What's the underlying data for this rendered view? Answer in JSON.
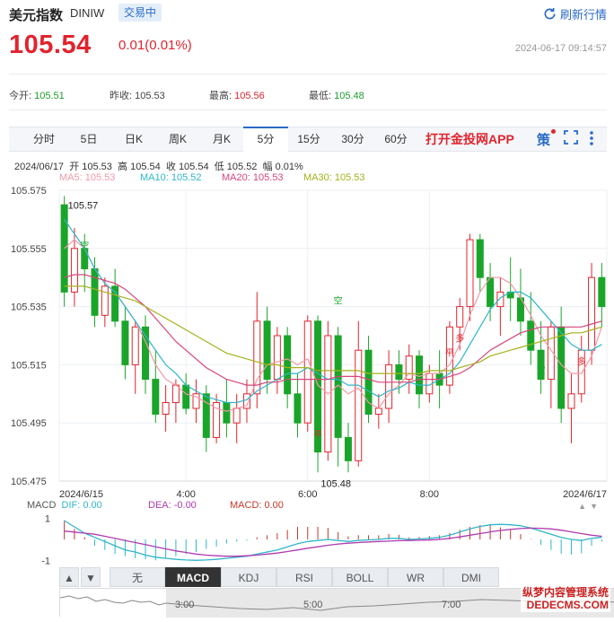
{
  "header": {
    "title": "美元指数",
    "code": "DINIW",
    "status": "交易中",
    "refresh_label": "刷新行情",
    "price": "105.54",
    "change": "0.01(0.01%)",
    "timestamp": "2024-06-17 09:14:57"
  },
  "stats": {
    "open_label": "今开:",
    "open": "105.51",
    "prev_label": "昨收:",
    "prev": "105.53",
    "high_label": "最高:",
    "high": "105.56",
    "low_label": "最低:",
    "low": "105.48"
  },
  "tabs": [
    "分时",
    "5日",
    "日K",
    "周K",
    "月K",
    "5分",
    "15分",
    "30分",
    "60分"
  ],
  "active_tab": "5分",
  "app_link": "打开金投网APP",
  "toolbar_icons": [
    "strategy-icon",
    "fullscreen-icon",
    "more-icon"
  ],
  "strategy_label": "策",
  "bar_info": {
    "date": "2024/06/17",
    "open_label": "开",
    "open": "105.53",
    "high_label": "高",
    "high": "105.54",
    "close_label": "收",
    "close": "105.54",
    "low_label": "低",
    "low": "105.52",
    "amp_label": "幅",
    "amp": "0.01%"
  },
  "ma_legend": [
    {
      "label": "MA5: 105.53",
      "color": "#f09aa8"
    },
    {
      "label": "MA10: 105.52",
      "color": "#2fb6c8"
    },
    {
      "label": "MA20: 105.53",
      "color": "#d6457d"
    },
    {
      "label": "MA30: 105.53",
      "color": "#a3b21c"
    }
  ],
  "macd_legend": {
    "name": "MACD",
    "dif": "DIF: 0.00",
    "dea": "DEA: -0.00",
    "macd": "MACD: 0.00",
    "dif_color": "#2fb6c8",
    "dea_color": "#b03ab0",
    "macd_color": "#c0392b"
  },
  "indicator_tabs": [
    "无",
    "MACD",
    "KDJ",
    "RSI",
    "BOLL",
    "WR",
    "DMI"
  ],
  "active_indicator": "MACD",
  "nav_arrows": [
    "▲",
    "▼"
  ],
  "navigator_ticks": [
    "3:00",
    "5:00",
    "7:00"
  ],
  "watermark": {
    "line1": "纵梦内容管理系统",
    "line2": "DEDECMS.COM"
  },
  "chart_data": {
    "type": "candlestick",
    "y_ticks": [
      "105.575",
      "105.555",
      "105.535",
      "105.515",
      "105.495",
      "105.475"
    ],
    "ylim": [
      105.475,
      105.575
    ],
    "x_ticks": [
      "2024/6/15",
      "4:00",
      "6:00",
      "8:00",
      "2024/6/17"
    ],
    "annotations": {
      "max": "105.57",
      "min": "105.48",
      "short": "空",
      "long": "多",
      "flat": "平"
    },
    "colors": {
      "up": "#e0242e",
      "down": "#1aa52a"
    },
    "candles": [
      [
        105.57,
        105.573,
        105.535,
        105.54
      ],
      [
        105.54,
        105.562,
        105.535,
        105.555
      ],
      [
        105.555,
        105.56,
        105.54,
        105.548
      ],
      [
        105.548,
        105.552,
        105.528,
        105.532
      ],
      [
        105.532,
        105.545,
        105.528,
        105.542
      ],
      [
        105.542,
        105.548,
        105.528,
        105.53
      ],
      [
        105.53,
        105.535,
        105.51,
        105.515
      ],
      [
        105.515,
        105.53,
        105.505,
        105.528
      ],
      [
        105.528,
        105.532,
        105.505,
        105.51
      ],
      [
        105.51,
        105.52,
        105.495,
        105.498
      ],
      [
        105.498,
        105.508,
        105.492,
        105.502
      ],
      [
        105.502,
        105.51,
        105.495,
        105.508
      ],
      [
        105.508,
        105.512,
        105.498,
        105.5
      ],
      [
        105.5,
        105.51,
        105.495,
        105.505
      ],
      [
        105.505,
        105.508,
        105.485,
        105.49
      ],
      [
        105.49,
        105.505,
        105.488,
        105.502
      ],
      [
        105.502,
        105.51,
        105.49,
        105.495
      ],
      [
        105.495,
        105.505,
        105.488,
        105.5
      ],
      [
        105.5,
        105.51,
        105.495,
        105.505
      ],
      [
        105.505,
        105.54,
        105.5,
        105.53
      ],
      [
        105.53,
        105.535,
        105.505,
        105.51
      ],
      [
        105.51,
        105.528,
        105.505,
        105.525
      ],
      [
        105.525,
        105.528,
        105.5,
        105.505
      ],
      [
        105.505,
        105.512,
        105.49,
        105.495
      ],
      [
        105.495,
        105.532,
        105.492,
        105.53
      ],
      [
        105.53,
        105.532,
        105.478,
        105.485
      ],
      [
        105.485,
        105.53,
        105.482,
        105.525
      ],
      [
        105.525,
        105.528,
        105.48,
        105.49
      ],
      [
        105.49,
        105.495,
        105.478,
        105.482
      ],
      [
        105.482,
        105.53,
        105.48,
        105.52
      ],
      [
        105.52,
        105.525,
        105.495,
        105.498
      ],
      [
        105.498,
        105.505,
        105.493,
        105.5
      ],
      [
        105.5,
        105.52,
        105.495,
        105.515
      ],
      [
        105.515,
        105.52,
        105.505,
        105.51
      ],
      [
        105.51,
        105.522,
        105.505,
        105.518
      ],
      [
        105.518,
        105.52,
        105.5,
        105.505
      ],
      [
        105.505,
        105.515,
        105.502,
        105.512
      ],
      [
        105.512,
        105.52,
        105.5,
        105.508
      ],
      [
        105.508,
        105.53,
        105.505,
        105.528
      ],
      [
        105.528,
        105.538,
        105.52,
        105.535
      ],
      [
        105.535,
        105.56,
        105.53,
        105.558
      ],
      [
        105.558,
        105.56,
        105.54,
        105.545
      ],
      [
        105.545,
        105.55,
        105.53,
        105.535
      ],
      [
        105.535,
        105.545,
        105.525,
        105.54
      ],
      [
        105.54,
        105.552,
        105.53,
        105.538
      ],
      [
        105.538,
        105.548,
        105.525,
        105.53
      ],
      [
        105.53,
        105.54,
        105.515,
        105.52
      ],
      [
        105.52,
        105.53,
        105.505,
        105.51
      ],
      [
        105.51,
        105.53,
        105.5,
        105.528
      ],
      [
        105.528,
        105.535,
        105.495,
        105.5
      ],
      [
        105.5,
        105.512,
        105.488,
        105.505
      ],
      [
        105.505,
        105.525,
        105.502,
        105.52
      ],
      [
        105.52,
        105.55,
        105.515,
        105.545
      ],
      [
        105.545,
        105.55,
        105.528,
        105.535
      ]
    ],
    "series": [
      {
        "name": "MA5",
        "color": "#f09aa8",
        "values": [
          105.555,
          105.558,
          105.555,
          105.548,
          105.543,
          105.54,
          105.535,
          105.53,
          105.523,
          105.515,
          105.51,
          105.508,
          105.505,
          105.504,
          105.502,
          105.5,
          105.499,
          105.5,
          105.501,
          105.51,
          105.515,
          105.516,
          105.517,
          105.515,
          105.517,
          105.508,
          105.505,
          105.508,
          105.505,
          105.507,
          105.502,
          105.5,
          105.505,
          105.508,
          105.512,
          105.511,
          105.512,
          105.512,
          105.515,
          105.522,
          105.532,
          105.54,
          105.545,
          105.545,
          105.543,
          105.538,
          105.532,
          105.525,
          105.52,
          105.515,
          105.512,
          105.512,
          105.518,
          105.528
        ]
      },
      {
        "name": "MA10",
        "color": "#2fb6c8",
        "values": [
          105.565,
          105.56,
          105.555,
          105.548,
          105.543,
          105.54,
          105.535,
          105.53,
          105.525,
          105.52,
          105.515,
          105.512,
          105.508,
          105.506,
          105.504,
          105.503,
          105.502,
          105.502,
          105.503,
          105.506,
          105.508,
          105.51,
          105.512,
          105.512,
          105.514,
          105.512,
          105.51,
          105.51,
          105.508,
          105.508,
          105.506,
          105.504,
          105.506,
          105.507,
          105.509,
          105.508,
          105.508,
          105.51,
          105.512,
          105.516,
          105.522,
          105.528,
          105.534,
          105.538,
          105.54,
          105.54,
          105.538,
          105.534,
          105.53,
          105.526,
          105.522,
          105.52,
          105.52,
          105.522
        ]
      },
      {
        "name": "MA20",
        "color": "#d6457d",
        "values": [
          105.545,
          105.546,
          105.546,
          105.545,
          105.544,
          105.543,
          105.541,
          105.538,
          105.535,
          105.531,
          105.527,
          105.523,
          105.52,
          105.517,
          105.514,
          105.512,
          105.51,
          105.509,
          105.508,
          105.508,
          105.509,
          105.509,
          105.51,
          105.51,
          105.51,
          105.51,
          105.51,
          105.511,
          105.511,
          105.511,
          105.51,
          105.509,
          105.509,
          105.509,
          105.509,
          105.51,
          105.51,
          105.51,
          105.511,
          105.512,
          105.514,
          105.517,
          105.52,
          105.522,
          105.524,
          105.526,
          105.527,
          105.528,
          105.528,
          105.528,
          105.528,
          105.528,
          105.529,
          105.53
        ]
      },
      {
        "name": "MA30",
        "color": "#a3b21c",
        "values": [
          105.542,
          105.542,
          105.542,
          105.541,
          105.54,
          105.539,
          105.538,
          105.537,
          105.535,
          105.533,
          105.531,
          105.529,
          105.527,
          105.525,
          105.523,
          105.521,
          105.519,
          105.518,
          105.517,
          105.516,
          105.515,
          105.515,
          105.514,
          105.514,
          105.514,
          105.513,
          105.513,
          105.513,
          105.513,
          105.513,
          105.512,
          105.512,
          105.512,
          105.512,
          105.512,
          105.512,
          105.513,
          105.513,
          105.513,
          105.514,
          105.515,
          105.516,
          105.518,
          105.519,
          105.52,
          105.521,
          105.522,
          105.523,
          105.524,
          105.525,
          105.526,
          105.526,
          105.527,
          105.528
        ]
      }
    ],
    "macd": {
      "y_ticks": [
        "1",
        "-1"
      ],
      "ylim": [
        -1.2,
        1.2
      ],
      "dif": [
        0.9,
        0.6,
        0.3,
        0.1,
        -0.1,
        -0.3,
        -0.5,
        -0.6,
        -0.75,
        -0.85,
        -0.9,
        -0.95,
        -0.98,
        -1.0,
        -0.98,
        -0.95,
        -0.9,
        -0.85,
        -0.8,
        -0.7,
        -0.6,
        -0.5,
        -0.35,
        -0.2,
        -0.1,
        -0.05,
        0.0,
        -0.05,
        -0.1,
        -0.05,
        -0.02,
        0.0,
        0.05,
        0.05,
        0.0,
        0.02,
        0.05,
        0.1,
        0.2,
        0.35,
        0.5,
        0.62,
        0.7,
        0.72,
        0.7,
        0.65,
        0.55,
        0.4,
        0.25,
        0.1,
        0.0,
        -0.05,
        0.05,
        0.1
      ],
      "dea": [
        0.4,
        0.35,
        0.3,
        0.25,
        0.15,
        0.05,
        -0.05,
        -0.15,
        -0.25,
        -0.35,
        -0.45,
        -0.55,
        -0.62,
        -0.7,
        -0.75,
        -0.78,
        -0.8,
        -0.8,
        -0.78,
        -0.75,
        -0.7,
        -0.65,
        -0.58,
        -0.5,
        -0.42,
        -0.35,
        -0.28,
        -0.22,
        -0.18,
        -0.15,
        -0.12,
        -0.1,
        -0.08,
        -0.06,
        -0.05,
        -0.04,
        -0.03,
        0.0,
        0.05,
        0.12,
        0.2,
        0.28,
        0.36,
        0.43,
        0.48,
        0.52,
        0.54,
        0.53,
        0.5,
        0.44,
        0.36,
        0.28,
        0.2,
        0.15
      ],
      "hist": [
        0.9,
        0.5,
        0.1,
        -0.3,
        -0.5,
        -0.7,
        -0.8,
        -0.9,
        -0.95,
        -1.0,
        -0.9,
        -0.8,
        -0.7,
        -0.6,
        -0.45,
        -0.35,
        -0.2,
        -0.1,
        -0.05,
        0.1,
        0.2,
        0.3,
        0.45,
        0.6,
        0.6,
        0.6,
        0.55,
        0.35,
        0.15,
        0.2,
        0.2,
        0.2,
        0.26,
        0.22,
        0.1,
        0.12,
        0.16,
        0.2,
        0.3,
        0.46,
        0.6,
        0.68,
        0.68,
        0.58,
        0.44,
        0.26,
        0.02,
        -0.26,
        -0.5,
        -0.68,
        -0.72,
        -0.66,
        -0.3,
        -0.1
      ]
    }
  }
}
